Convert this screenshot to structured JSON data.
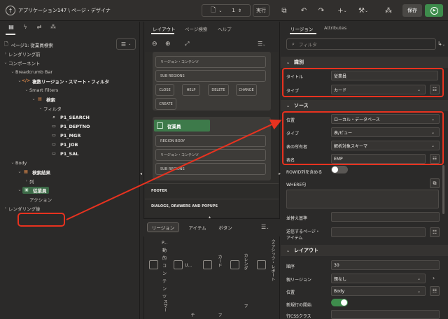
{
  "topbar": {
    "home_icon": "up-arrow-circle-icon",
    "breadcrumb": "アプリケーション147 \\ ページ・デザイナ",
    "page_number": "1",
    "run_label": "実行",
    "save_label": "保存"
  },
  "left": {
    "page_title": "ページ1: 従業員検索",
    "tree": [
      {
        "label": "レンダリング前",
        "indent": 0,
        "twisty": "›",
        "icon": ""
      },
      {
        "label": "コンポーネント",
        "indent": 0,
        "twisty": "⌄",
        "icon": ""
      },
      {
        "label": "Breadcrumb Bar",
        "indent": 1,
        "twisty": "⌄",
        "icon": ""
      },
      {
        "label": "複数リージョン・スマート・フィルタ",
        "indent": 2,
        "twisty": "⌄",
        "icon": "code",
        "bold": true
      },
      {
        "label": "Smart Filters",
        "indent": 3,
        "twisty": "⌄",
        "icon": ""
      },
      {
        "label": "検索",
        "indent": 4,
        "twisty": "⌄",
        "icon": "filter",
        "bold": true
      },
      {
        "label": "フィルタ",
        "indent": 5,
        "twisty": "⌄",
        "icon": ""
      },
      {
        "label": "P1_SEARCH",
        "indent": 6,
        "twisty": "",
        "icon": "search",
        "bold": true
      },
      {
        "label": "P1_DEPTNO",
        "indent": 6,
        "twisty": "",
        "icon": "box",
        "bold": true
      },
      {
        "label": "P1_MGR",
        "indent": 6,
        "twisty": "",
        "icon": "box",
        "bold": true
      },
      {
        "label": "P1_JOB",
        "indent": 6,
        "twisty": "",
        "icon": "box",
        "bold": true
      },
      {
        "label": "P1_SAL",
        "indent": 6,
        "twisty": "",
        "icon": "box",
        "bold": true
      },
      {
        "label": "Body",
        "indent": 1,
        "twisty": "⌄",
        "icon": ""
      },
      {
        "label": "検索結果",
        "indent": 2,
        "twisty": "⌄",
        "icon": "grid",
        "bold": true
      },
      {
        "label": "列",
        "indent": 3,
        "twisty": "›",
        "icon": ""
      },
      {
        "label": "従業員",
        "indent": 2,
        "twisty": "⌄",
        "icon": "card",
        "bold": true,
        "selected": true
      },
      {
        "label": "アクション",
        "indent": 3,
        "twisty": "",
        "icon": ""
      },
      {
        "label": "レンダリング後",
        "indent": 0,
        "twisty": "›",
        "icon": ""
      }
    ]
  },
  "middle": {
    "tabs": [
      "レイアウト",
      "ページ検索",
      "ヘルプ"
    ],
    "top_card": {
      "slots": [
        "リージョン・コンテンツ",
        "SUB REGIONS"
      ],
      "buttons": [
        "CLOSE",
        "HELP",
        "DELETE",
        "CHANGE",
        "CREATE"
      ]
    },
    "region_card": {
      "title": "従業員",
      "slots": [
        "REGION BODY",
        "リージョン・コンテンツ",
        "SUB REGIONS"
      ]
    },
    "strips": [
      "FOOTER",
      "DIALOGS, DRAWERS AND POPUPS"
    ],
    "gallery_tabs": [
      "リージョン",
      "アイテム",
      "ボタン"
    ],
    "gallery": {
      "col1": [
        "P...",
        "動",
        "的",
        "コ",
        "ン",
        "テ",
        "ン",
        "ツ"
      ],
      "col2": "U...",
      "col3": "カード",
      "col4": "カレンダ",
      "col5": "クラシック・レポート",
      "bottom1": "スマー",
      "bottom2": "チ",
      "bottom3": "フ",
      "bottom4": "フ"
    }
  },
  "right": {
    "tabs": [
      "リージョン",
      "Attributes"
    ],
    "filter_placeholder": "フィルタ",
    "sections": {
      "identification": "識別",
      "source": "ソース",
      "layout": "レイアウト"
    },
    "props": {
      "title_label": "タイトル",
      "title_value": "従業員",
      "type_label": "タイプ",
      "type_value": "カード",
      "location_label": "位置",
      "location_value": "ローカル・データベース",
      "source_type_label": "タイプ",
      "source_type_value": "表/ビュー",
      "owner_label": "表の所有者",
      "owner_value": "解析対象スキーマ",
      "table_label": "表名",
      "table_value": "EMP",
      "rowid_label": "ROWID列を含める",
      "where_label": "WHERE句",
      "orderby_label": "並替え基準",
      "submit_label": "送信するページ・",
      "submit_label2": "アイテム",
      "seq_label": "順序",
      "seq_value": "30",
      "parent_label": "親リージョン",
      "parent_value": "親なし",
      "pos_label": "位置",
      "pos_value": "Body",
      "newrow_label": "新規行の開始",
      "rowcss_label": "行CSSクラス"
    }
  },
  "colors": {
    "accent_green": "#3d7a4a",
    "highlight_red": "#e8321f"
  }
}
